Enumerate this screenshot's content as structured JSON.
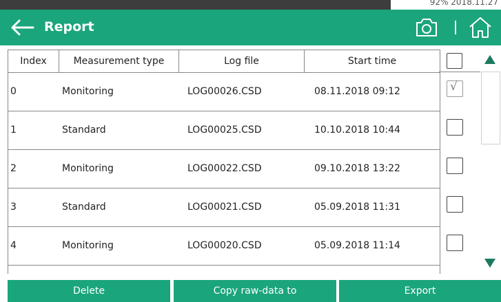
{
  "statusbar": {
    "text": "92%   2018.11.27"
  },
  "header": {
    "title": "Report"
  },
  "table": {
    "columns": [
      "Index",
      "Measurement type",
      "Log file",
      "Start time"
    ],
    "rows": [
      {
        "index": "0",
        "type": "Monitoring",
        "file": "LOG00026.CSD",
        "start": "08.11.2018 09:12",
        "checked": true
      },
      {
        "index": "1",
        "type": "Standard",
        "file": "LOG00025.CSD",
        "start": "10.10.2018 10:44",
        "checked": false
      },
      {
        "index": "2",
        "type": "Monitoring",
        "file": "LOG00022.CSD",
        "start": "09.10.2018 13:22",
        "checked": false
      },
      {
        "index": "3",
        "type": "Standard",
        "file": "LOG00021.CSD",
        "start": "05.09.2018 11:31",
        "checked": false
      },
      {
        "index": "4",
        "type": "Monitoring",
        "file": "LOG00020.CSD",
        "start": "05.09.2018 11:14",
        "checked": false
      }
    ],
    "check_mark": "√"
  },
  "buttons": {
    "delete": "Delete",
    "copy": "Copy raw-data to",
    "export": "Export"
  },
  "colors": {
    "accent": "#1ba57c",
    "scroll_arrow": "#1b7a60"
  },
  "icons": {
    "back": "arrow-left-icon",
    "camera": "camera-icon",
    "home": "home-icon"
  }
}
